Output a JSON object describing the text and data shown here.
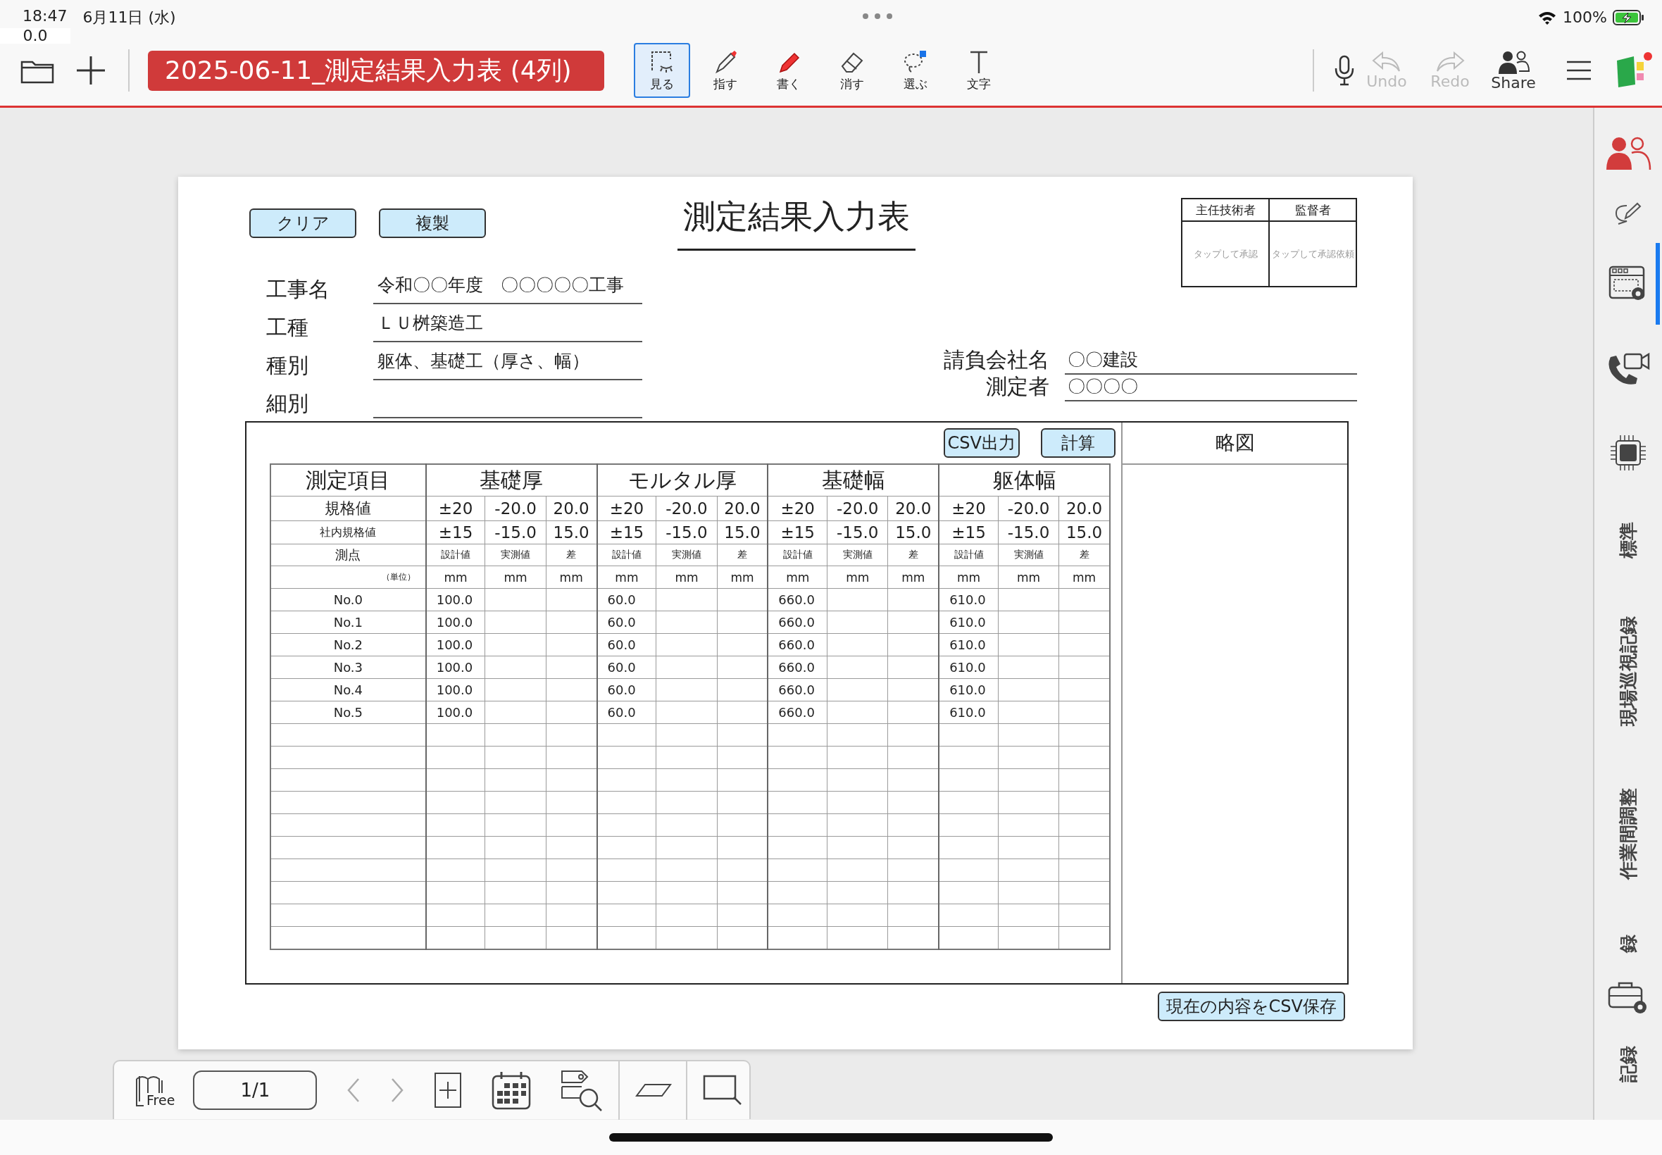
{
  "status_bar": {
    "time": "18:47",
    "date": "6月11日 (水)",
    "sub_value": "0.0",
    "battery": "100%"
  },
  "toolbar": {
    "title": "2025-06-11_測定結果入力表 (4列)",
    "tools": [
      {
        "kind": "view",
        "label": "見る",
        "selected": true
      },
      {
        "kind": "point",
        "label": "指す",
        "selected": false
      },
      {
        "kind": "write",
        "label": "書く",
        "selected": false
      },
      {
        "kind": "erase",
        "label": "消す",
        "selected": false
      },
      {
        "kind": "select",
        "label": "選ぶ",
        "selected": false
      },
      {
        "kind": "text",
        "label": "文字",
        "selected": false
      }
    ],
    "actions": [
      {
        "kind": "undo",
        "label": "Undo",
        "disabled": true
      },
      {
        "kind": "redo",
        "label": "Redo",
        "disabled": true
      },
      {
        "kind": "share",
        "label": "Share",
        "disabled": false
      }
    ]
  },
  "document": {
    "buttons": [
      "クリア",
      "複製"
    ],
    "title": "測定結果入力表",
    "approval": [
      {
        "heading": "主任技術者",
        "hint": "タップして承認"
      },
      {
        "heading": "監督者",
        "hint": "タップして承認依頼"
      }
    ],
    "fields": [
      {
        "label": "工事名",
        "value": "令和〇〇年度　〇〇〇〇〇工事"
      },
      {
        "label": "工種",
        "value": "ＬＵ桝築造工"
      },
      {
        "label": "種別",
        "value": "躯体、基礎工（厚さ、幅）"
      },
      {
        "label": "細別"
      }
    ],
    "company_fields": [
      {
        "label": "請負会社名",
        "value": "〇〇建設"
      },
      {
        "label": "測定者",
        "value": "〇〇〇〇"
      }
    ],
    "table_buttons": [
      "CSV出力",
      "計算"
    ],
    "table": {
      "corner": "測定項目",
      "row_labels": [
        "規格値",
        "社内規格値",
        "測点",
        "（単位）"
      ],
      "groups": [
        {
          "name": "基礎厚",
          "spec": [
            "±20",
            "-20.0",
            "20.0"
          ],
          "internal": [
            "±15",
            "-15.0",
            "15.0"
          ],
          "subheads": [
            "設計値",
            "実測値",
            "差"
          ],
          "units": [
            "mm",
            "mm",
            "mm"
          ]
        },
        {
          "name": "モルタル厚",
          "spec": [
            "±20",
            "-20.0",
            "20.0"
          ],
          "internal": [
            "±15",
            "-15.0",
            "15.0"
          ],
          "subheads": [
            "設計値",
            "実測値",
            "差"
          ],
          "units": [
            "mm",
            "mm",
            "mm"
          ]
        },
        {
          "name": "基礎幅",
          "spec": [
            "±20",
            "-20.0",
            "20.0"
          ],
          "internal": [
            "±15",
            "-15.0",
            "15.0"
          ],
          "subheads": [
            "設計値",
            "実測値",
            "差"
          ],
          "units": [
            "mm",
            "mm",
            "mm"
          ]
        },
        {
          "name": "躯体幅",
          "spec": [
            "±20",
            "-20.0",
            "20.0"
          ],
          "internal": [
            "±15",
            "-15.0",
            "15.0"
          ],
          "subheads": [
            "設計値",
            "実測値",
            "差"
          ],
          "units": [
            "mm",
            "mm",
            "mm"
          ]
        }
      ],
      "rows": [
        {
          "point": "No.0",
          "design": [
            "100.0",
            "60.0",
            "660.0",
            "610.0"
          ]
        },
        {
          "point": "No.1",
          "design": [
            "100.0",
            "60.0",
            "660.0",
            "610.0"
          ]
        },
        {
          "point": "No.2",
          "design": [
            "100.0",
            "60.0",
            "660.0",
            "610.0"
          ]
        },
        {
          "point": "No.3",
          "design": [
            "100.0",
            "60.0",
            "660.0",
            "610.0"
          ]
        },
        {
          "point": "No.4",
          "design": [
            "100.0",
            "60.0",
            "660.0",
            "610.0"
          ]
        },
        {
          "point": "No.5",
          "design": [
            "100.0",
            "60.0",
            "660.0",
            "610.0"
          ]
        }
      ]
    },
    "sketch_heading": "略図",
    "save_button": "現在の内容をCSV保存"
  },
  "sidebar": {
    "items": [
      {
        "kind": "members",
        "selected": false
      },
      {
        "kind": "annotate",
        "selected": false
      },
      {
        "kind": "layout-settings",
        "selected": true
      },
      {
        "kind": "video-call",
        "selected": false
      },
      {
        "kind": "ai",
        "selected": false
      },
      {
        "kind": "tab",
        "label": "標準",
        "selected": false
      },
      {
        "kind": "tab",
        "label": "現場巡視記録",
        "selected": false
      },
      {
        "kind": "tab",
        "label": "作業間調整",
        "selected": false
      },
      {
        "kind": "tab",
        "label": "録",
        "selected": false
      },
      {
        "kind": "toolbox",
        "selected": false
      },
      {
        "kind": "tab",
        "label": "記録",
        "selected": false
      }
    ]
  },
  "bottom_bar": {
    "free_label": "Free",
    "page": "1/1"
  }
}
